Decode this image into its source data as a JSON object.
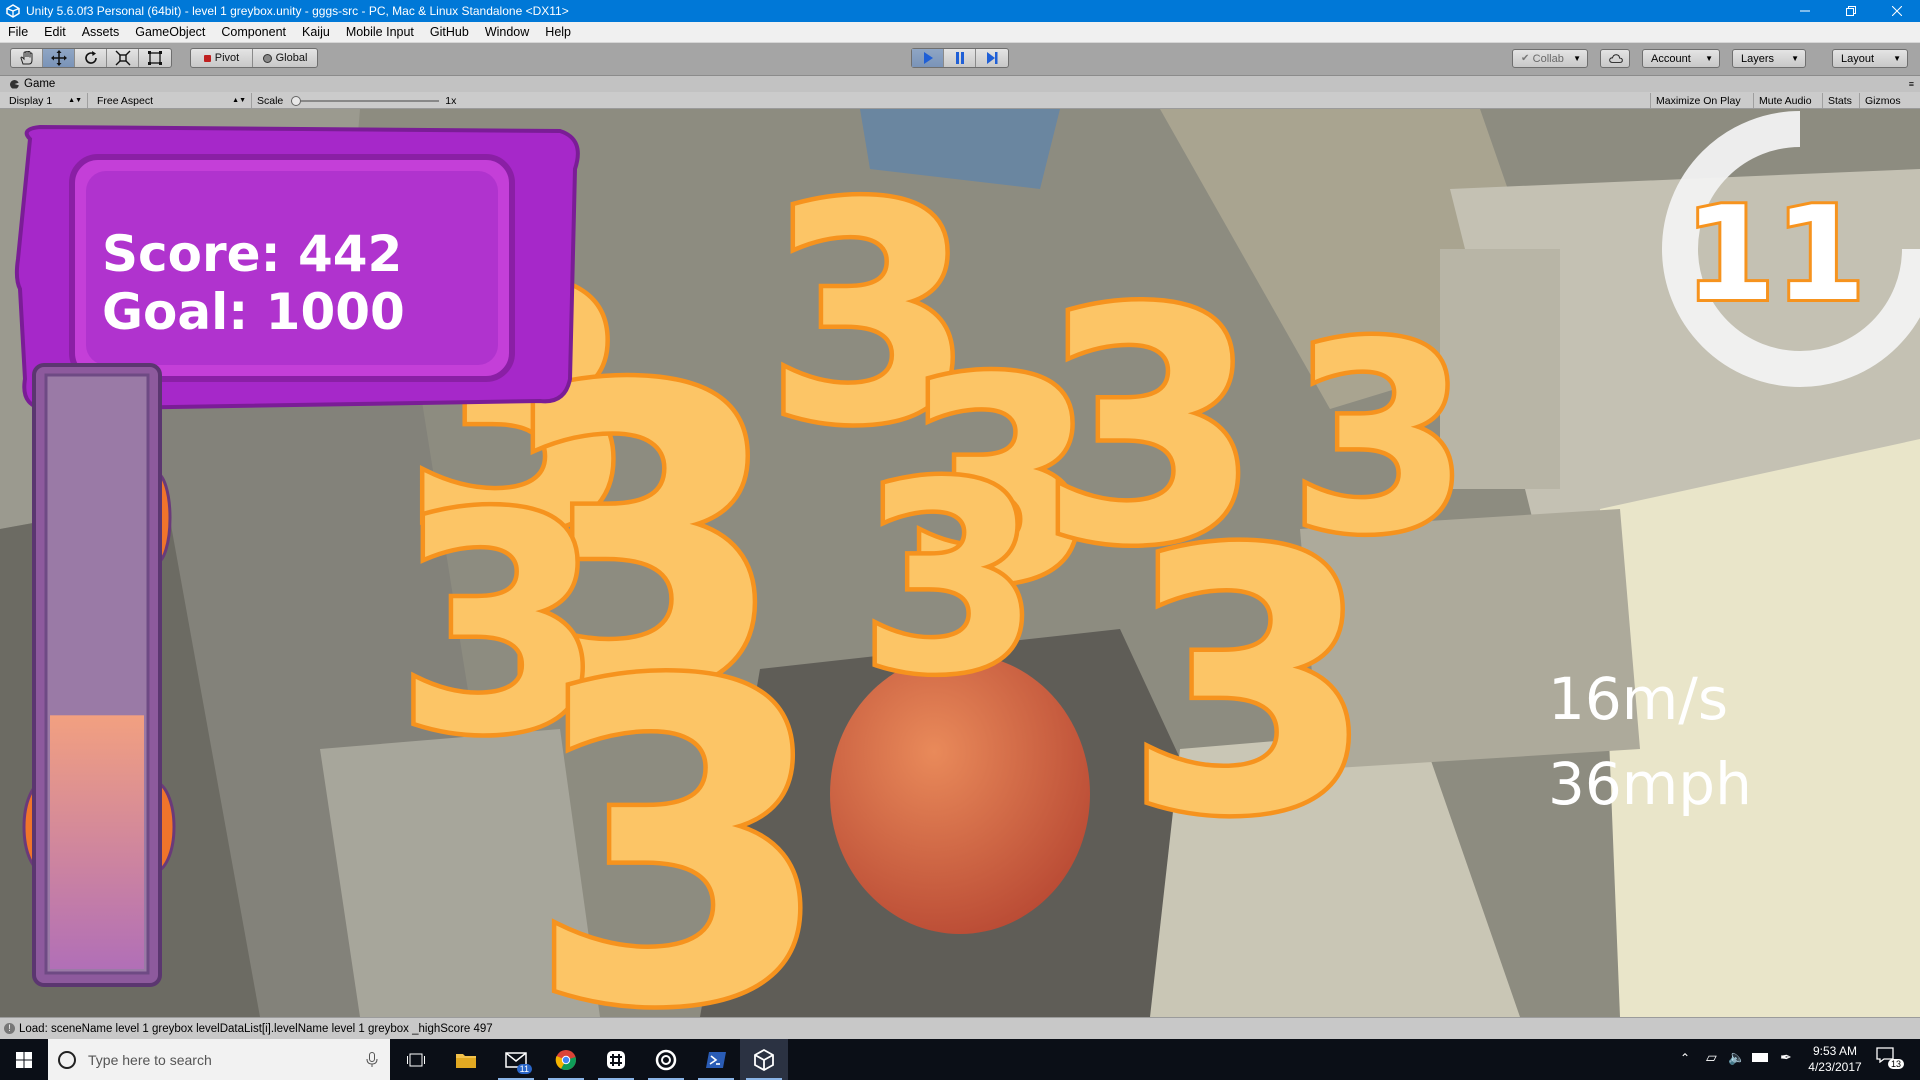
{
  "window": {
    "title": "Unity 5.6.0f3 Personal (64bit) - level 1 greybox.unity - gggs-src - PC, Mac & Linux Standalone <DX11>",
    "controls": [
      "minimize",
      "restore",
      "close"
    ]
  },
  "menu": [
    "File",
    "Edit",
    "Assets",
    "GameObject",
    "Component",
    "Kaiju",
    "Mobile Input",
    "GitHub",
    "Window",
    "Help"
  ],
  "toolbar": {
    "transform_tools": [
      "hand-icon",
      "move-icon",
      "rotate-icon",
      "scale-icon",
      "rect-icon"
    ],
    "pivot_label": "Pivot",
    "global_label": "Global",
    "collab_label": "Collab",
    "account_label": "Account",
    "layers_label": "Layers",
    "layout_label": "Layout",
    "play_state": "playing",
    "accent": "#4b7bd6"
  },
  "game_view": {
    "tab_label": "Game",
    "display_label": "Display 1",
    "aspect_label": "Free Aspect",
    "scale_label": "Scale",
    "scale_value": "1x",
    "toggles": [
      "Maximize On Play",
      "Mute Audio",
      "Stats",
      "Gizmos"
    ]
  },
  "hud": {
    "score_line": "Score: 442",
    "goal_line": "Goal: 1000",
    "countdown": "11",
    "speed_ms": "16m/s",
    "speed_mph": "36mph",
    "meter_fill_fraction": 0.43,
    "popup_digit": "3",
    "panel_color": "#a628c9",
    "popup_fill": "#fcc566",
    "popup_stroke": "#f6931e"
  },
  "status_bar": {
    "message": "Load: sceneName level 1 greybox levelDataList[i].levelName level 1 greybox _highScore 497"
  },
  "taskbar": {
    "search_placeholder": "Type here to search",
    "mail_badge": "11",
    "time": "9:53 AM",
    "date": "4/23/2017",
    "notification_count": "13"
  }
}
